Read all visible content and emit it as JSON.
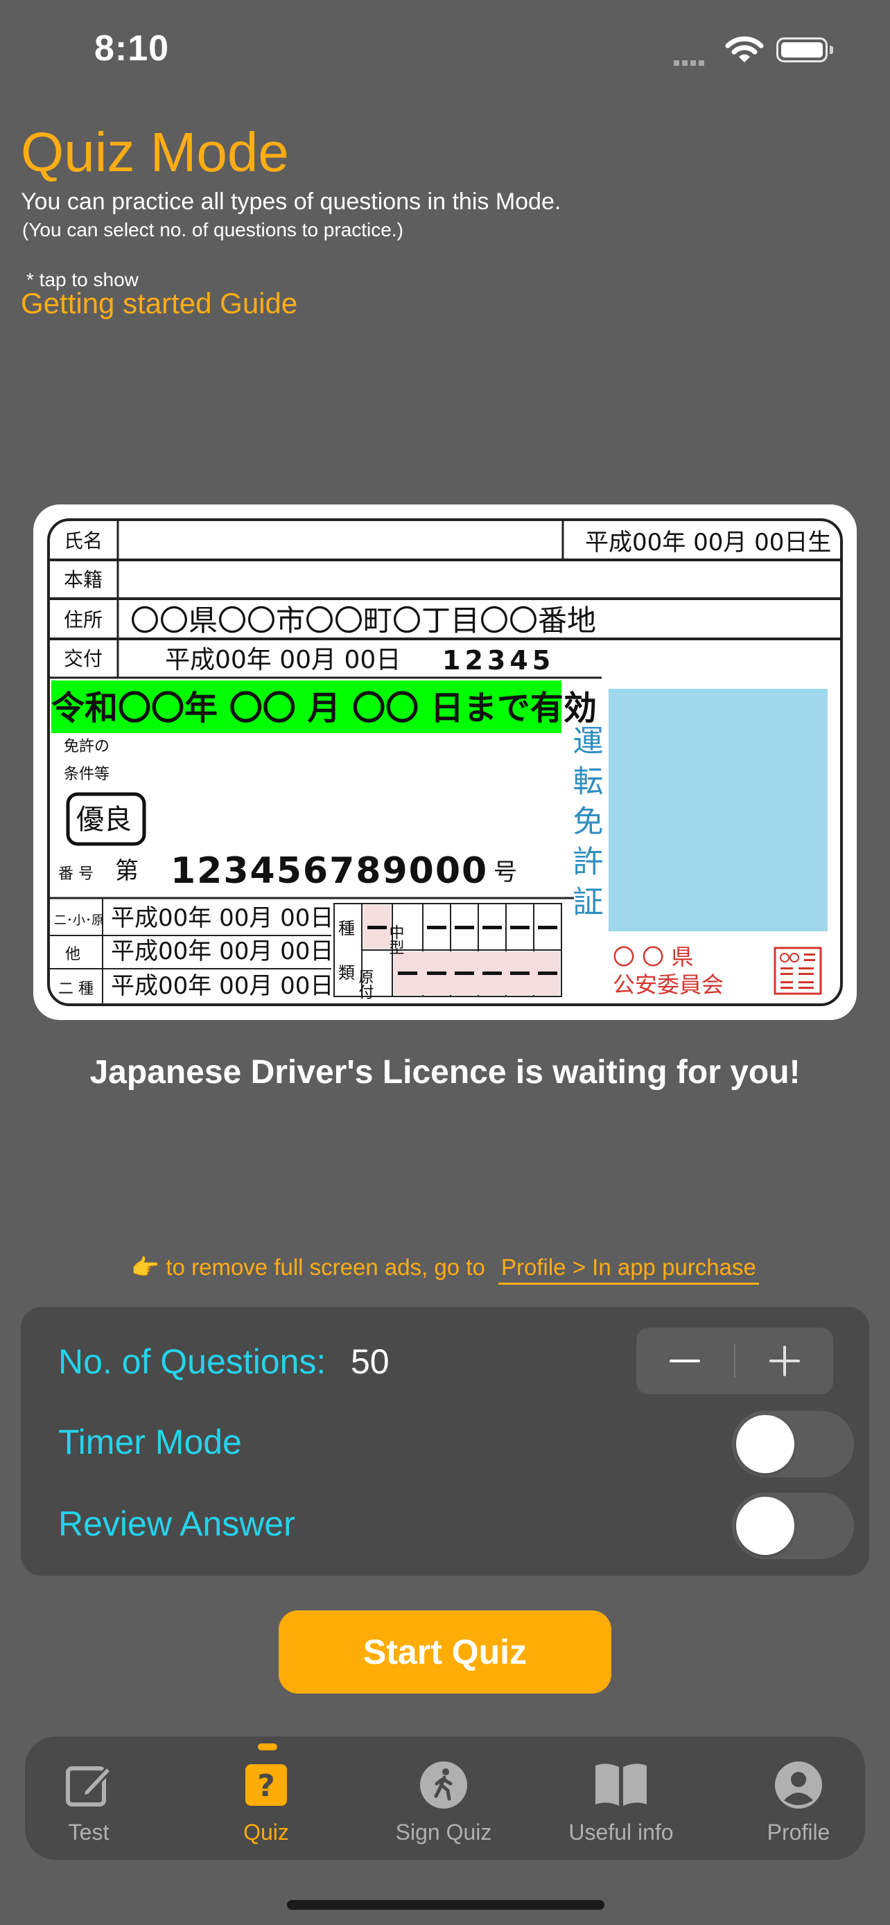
{
  "status_bar": {
    "time": "8:10"
  },
  "header": {
    "title": "Quiz Mode",
    "subtitle": "You can practice all types of questions in this Mode.",
    "subnote": "(You can select no. of questions to practice.)",
    "tap_note": "* tap to show",
    "guide_link": "Getting started Guide"
  },
  "license_card": {
    "name_label": "氏名",
    "birth_date": "平成00年 00月 00日生",
    "domicile_label": "本籍",
    "address_label": "住所",
    "address": "〇〇県〇〇市〇〇町〇丁目〇〇番地",
    "issue_label": "交付",
    "issue_date": "平成00年 00月 00日",
    "issue_no": "12345",
    "valid_until": "令和〇〇年 〇〇 月 〇〇 日まで有効",
    "conditions_label_1": "免許の",
    "conditions_label_2": "条件等",
    "excellent_badge": "優良",
    "number_label": "番 号",
    "number_prefix": "第",
    "number": "123456789000",
    "number_suffix": "号",
    "license_vertical": "運転免許証",
    "class_labels": [
      "二･小･原",
      "他",
      "二 種"
    ],
    "class_dates": [
      "平成00年 00月 00日",
      "平成00年 00月 00日",
      "平成00年 00月 00日"
    ],
    "type_label_1": "種",
    "type_label_2": "類",
    "type_mid": "中型",
    "type_moped": "原付",
    "commission_1": "〇  〇  県",
    "commission_2": "公安委員会",
    "seal": "〇〇県公安委員会印",
    "photo_color": "#9fd7ec",
    "valid_highlight_color": "#00ff00"
  },
  "tagline": "Japanese Driver's Licence is waiting for you!",
  "ads_note": {
    "emoji": "👉",
    "text": "to remove full screen ads, go to",
    "link": "Profile > In app purchase"
  },
  "settings": {
    "questions_label": "No. of Questions:",
    "questions_value": "50",
    "timer_label": "Timer Mode",
    "timer_on": false,
    "review_label": "Review Answer",
    "review_on": false
  },
  "start_button": "Start Quiz",
  "tabs": [
    {
      "label": "Test",
      "icon": "edit-icon"
    },
    {
      "label": "Quiz",
      "icon": "question-icon",
      "active": true
    },
    {
      "label": "Sign Quiz",
      "icon": "walking-icon"
    },
    {
      "label": "Useful info",
      "icon": "book-icon"
    },
    {
      "label": "Profile",
      "icon": "person-icon"
    }
  ],
  "colors": {
    "accent": "#ffad05",
    "label": "#24d4ec",
    "background": "#5e5e5e",
    "panel": "#4a4a4a"
  }
}
